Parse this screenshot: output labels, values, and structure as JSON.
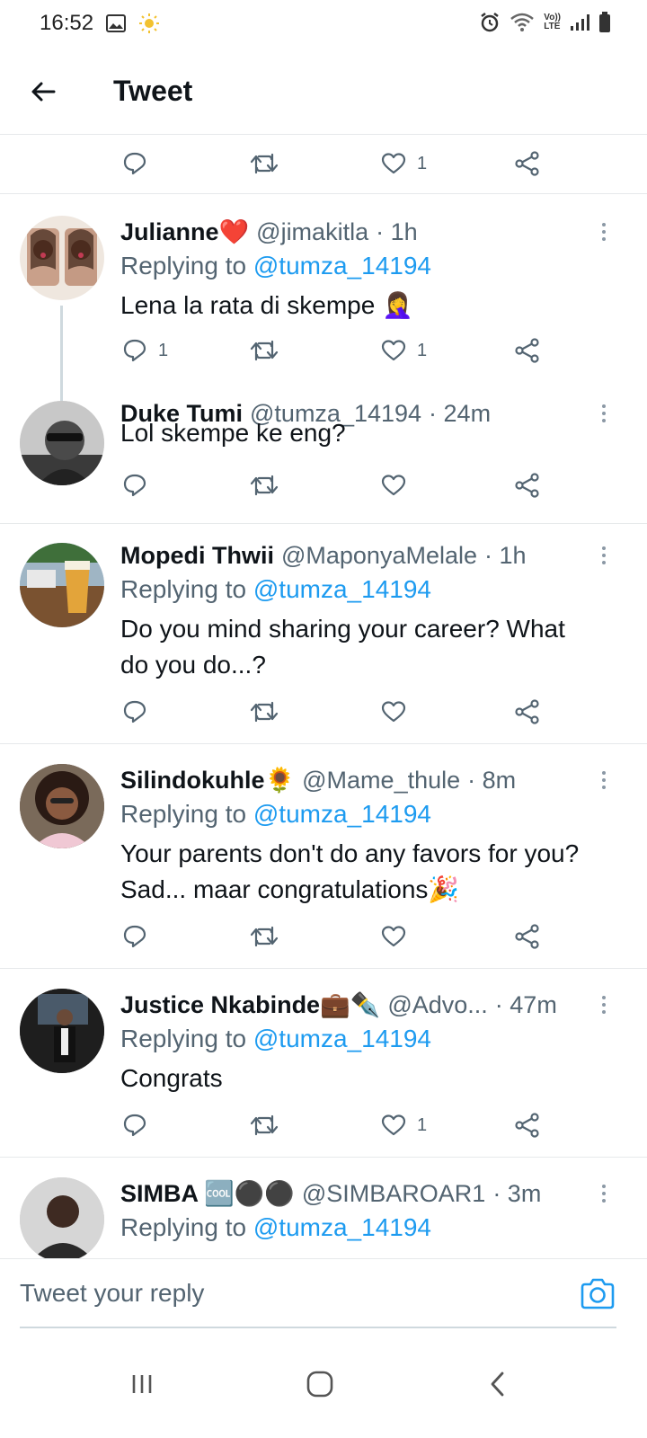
{
  "status_bar": {
    "time": "16:52",
    "signal_label_top": "Vo))",
    "signal_label_bottom": "LTE"
  },
  "header": {
    "title": "Tweet"
  },
  "top_actions": {
    "like_count": "1"
  },
  "tweets": [
    {
      "name": "Julianne",
      "name_emoji": "❤️",
      "handle": "@jimakitla",
      "time": "· 1h",
      "replying_label": "Replying to",
      "replying_handle": "@tumza_14194",
      "text": "Lena la rata di skempe 🤦‍♀️",
      "reply_count": "1",
      "retweet_count": "",
      "like_count": "1"
    },
    {
      "name": "Duke Tumi",
      "name_emoji": "",
      "handle": "@tumza_14194",
      "time": "· 24m",
      "text": "Lol skempe ke eng?",
      "reply_count": "",
      "retweet_count": "",
      "like_count": ""
    },
    {
      "name": "Mopedi Thwii",
      "name_emoji": "",
      "handle": "@MaponyaMelale",
      "time": "· 1h",
      "replying_label": "Replying to",
      "replying_handle": "@tumza_14194",
      "text_line1": "Do you mind sharing your career? What",
      "text_line2": "do you do...?",
      "reply_count": "",
      "retweet_count": "",
      "like_count": ""
    },
    {
      "name": "Silindokuhle",
      "name_emoji": "🌻",
      "handle": "@Mame_thule",
      "time": "· 8m",
      "replying_label": "Replying to",
      "replying_handle": "@tumza_14194",
      "text_line1": "Your parents don't do any favors for you?",
      "text_line2": "Sad... maar congratulations🎉",
      "reply_count": "",
      "retweet_count": "",
      "like_count": ""
    },
    {
      "name": "Justice Nkabinde",
      "name_emoji": "💼✒️",
      "handle": "@Advo...",
      "time": "· 47m",
      "replying_label": "Replying to",
      "replying_handle": "@tumza_14194",
      "text": "Congrats",
      "reply_count": "",
      "retweet_count": "",
      "like_count": "1"
    },
    {
      "name": "SIMBA",
      "name_emoji": "🆒⚫⚫",
      "handle": "@SIMBAROAR1",
      "time": "· 3m",
      "replying_label": "Replying to",
      "replying_handle": "@tumza_14194"
    }
  ],
  "reply_bar": {
    "placeholder": "Tweet your reply"
  },
  "colors": {
    "link": "#1d9bf0",
    "secondary_text": "#536471",
    "primary_text": "#0f1419",
    "divider": "#e6e9eb"
  },
  "icons": {
    "reply": "reply-icon",
    "retweet": "retweet-icon",
    "like": "heart-icon",
    "share": "share-icon",
    "more": "more-vertical-icon",
    "camera": "camera-icon",
    "back": "arrow-left-icon"
  }
}
